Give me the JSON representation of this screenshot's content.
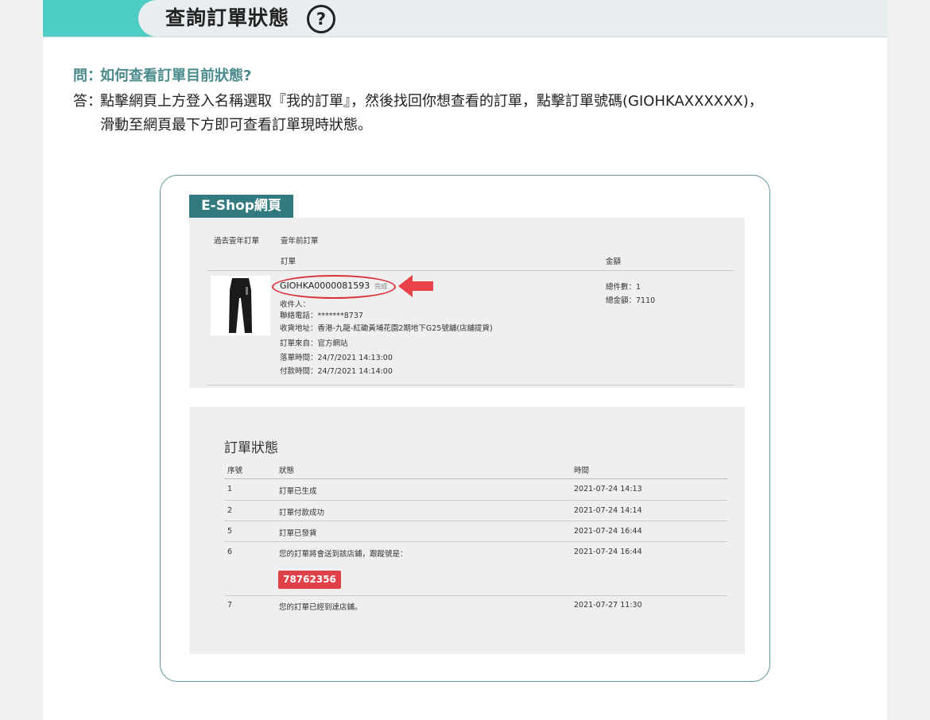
{
  "header": {
    "title": "查詢訂單狀態",
    "help_glyph": "?"
  },
  "qa": {
    "question_tag": "問：",
    "question": "如何查看訂單目前狀態?",
    "answer_tag": "答：",
    "answer_line1": "點擊網頁上方登入名稱選取『我的訂單』，然後找回你想查看的訂單，點擊訂單號碼(GIOHKAXXXXXX)，",
    "answer_line2": "滑動至網頁最下方即可查看訂單現時狀態。"
  },
  "eshop": {
    "label": "E-Shop網頁",
    "tab_past": "過去壹年訂單",
    "tab_before": "壹年前訂單",
    "col_order": "訂單",
    "col_amount": "金額",
    "order_number": "GIOHKA0000081593",
    "order_state": "完成",
    "receiver": "收件人：",
    "phone": "聯絡電話：*******8737",
    "address": "收貨地址：香港-九龍-紅磡黃埔花園2期地下G25號舖(店舖提貨)",
    "source": "訂單來自：官方網站",
    "created": "落單時間：24/7/2021 14:13:00",
    "paid": "付款時間：24/7/2021 14:14:00",
    "total_qty": "總件數：1",
    "total_amount": "總金額：7110",
    "product_icon": "pants-image",
    "annotation_icon": "red-arrow-icon",
    "annotation_color": "#d8323a"
  },
  "status": {
    "title": "訂單狀態",
    "headers": {
      "seq": "序號",
      "state": "狀態",
      "time": "時間"
    },
    "rows": [
      {
        "seq": "1",
        "state": "訂單已生成",
        "time": "2021-07-24 14:13"
      },
      {
        "seq": "2",
        "state": "訂單付款成功",
        "time": "2021-07-24 14:14"
      },
      {
        "seq": "5",
        "state": "訂單已發貨",
        "time": "2021-07-24 16:44"
      },
      {
        "seq": "6",
        "state": "您的訂單將會送到該店鋪，跟蹤號是：",
        "time": "2021-07-24 16:44"
      },
      {
        "seq": "7",
        "state": "您的訂單已經到達店鋪。",
        "time": "2021-07-27 11:30"
      }
    ],
    "tracking_number": "78762356",
    "badge_color": "#e04048"
  }
}
